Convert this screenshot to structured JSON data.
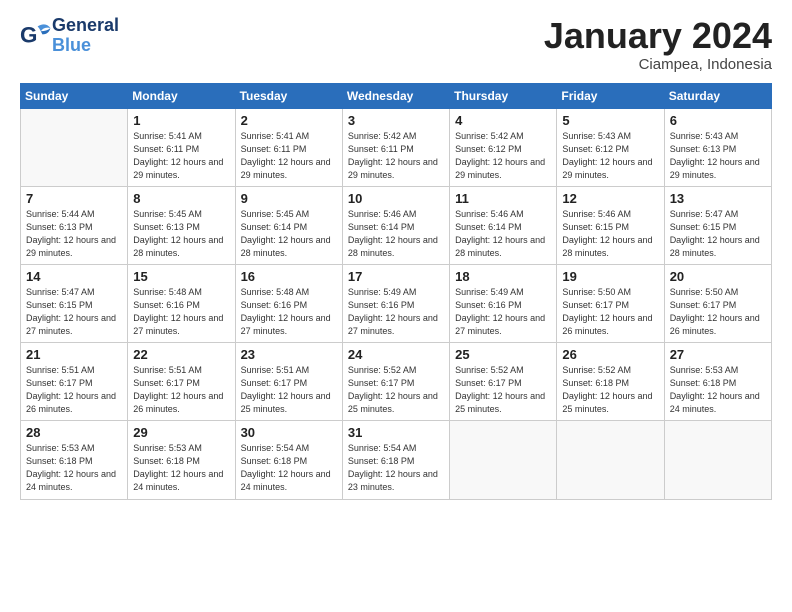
{
  "logo": {
    "line1": "General",
    "line2": "Blue"
  },
  "header": {
    "month": "January 2024",
    "location": "Ciampea, Indonesia"
  },
  "weekdays": [
    "Sunday",
    "Monday",
    "Tuesday",
    "Wednesday",
    "Thursday",
    "Friday",
    "Saturday"
  ],
  "weeks": [
    [
      {
        "day": "",
        "info": ""
      },
      {
        "day": "1",
        "info": "Sunrise: 5:41 AM\nSunset: 6:11 PM\nDaylight: 12 hours\nand 29 minutes."
      },
      {
        "day": "2",
        "info": "Sunrise: 5:41 AM\nSunset: 6:11 PM\nDaylight: 12 hours\nand 29 minutes."
      },
      {
        "day": "3",
        "info": "Sunrise: 5:42 AM\nSunset: 6:11 PM\nDaylight: 12 hours\nand 29 minutes."
      },
      {
        "day": "4",
        "info": "Sunrise: 5:42 AM\nSunset: 6:12 PM\nDaylight: 12 hours\nand 29 minutes."
      },
      {
        "day": "5",
        "info": "Sunrise: 5:43 AM\nSunset: 6:12 PM\nDaylight: 12 hours\nand 29 minutes."
      },
      {
        "day": "6",
        "info": "Sunrise: 5:43 AM\nSunset: 6:13 PM\nDaylight: 12 hours\nand 29 minutes."
      }
    ],
    [
      {
        "day": "7",
        "info": "Sunrise: 5:44 AM\nSunset: 6:13 PM\nDaylight: 12 hours\nand 29 minutes."
      },
      {
        "day": "8",
        "info": "Sunrise: 5:45 AM\nSunset: 6:13 PM\nDaylight: 12 hours\nand 28 minutes."
      },
      {
        "day": "9",
        "info": "Sunrise: 5:45 AM\nSunset: 6:14 PM\nDaylight: 12 hours\nand 28 minutes."
      },
      {
        "day": "10",
        "info": "Sunrise: 5:46 AM\nSunset: 6:14 PM\nDaylight: 12 hours\nand 28 minutes."
      },
      {
        "day": "11",
        "info": "Sunrise: 5:46 AM\nSunset: 6:14 PM\nDaylight: 12 hours\nand 28 minutes."
      },
      {
        "day": "12",
        "info": "Sunrise: 5:46 AM\nSunset: 6:15 PM\nDaylight: 12 hours\nand 28 minutes."
      },
      {
        "day": "13",
        "info": "Sunrise: 5:47 AM\nSunset: 6:15 PM\nDaylight: 12 hours\nand 28 minutes."
      }
    ],
    [
      {
        "day": "14",
        "info": "Sunrise: 5:47 AM\nSunset: 6:15 PM\nDaylight: 12 hours\nand 27 minutes."
      },
      {
        "day": "15",
        "info": "Sunrise: 5:48 AM\nSunset: 6:16 PM\nDaylight: 12 hours\nand 27 minutes."
      },
      {
        "day": "16",
        "info": "Sunrise: 5:48 AM\nSunset: 6:16 PM\nDaylight: 12 hours\nand 27 minutes."
      },
      {
        "day": "17",
        "info": "Sunrise: 5:49 AM\nSunset: 6:16 PM\nDaylight: 12 hours\nand 27 minutes."
      },
      {
        "day": "18",
        "info": "Sunrise: 5:49 AM\nSunset: 6:16 PM\nDaylight: 12 hours\nand 27 minutes."
      },
      {
        "day": "19",
        "info": "Sunrise: 5:50 AM\nSunset: 6:17 PM\nDaylight: 12 hours\nand 26 minutes."
      },
      {
        "day": "20",
        "info": "Sunrise: 5:50 AM\nSunset: 6:17 PM\nDaylight: 12 hours\nand 26 minutes."
      }
    ],
    [
      {
        "day": "21",
        "info": "Sunrise: 5:51 AM\nSunset: 6:17 PM\nDaylight: 12 hours\nand 26 minutes."
      },
      {
        "day": "22",
        "info": "Sunrise: 5:51 AM\nSunset: 6:17 PM\nDaylight: 12 hours\nand 26 minutes."
      },
      {
        "day": "23",
        "info": "Sunrise: 5:51 AM\nSunset: 6:17 PM\nDaylight: 12 hours\nand 25 minutes."
      },
      {
        "day": "24",
        "info": "Sunrise: 5:52 AM\nSunset: 6:17 PM\nDaylight: 12 hours\nand 25 minutes."
      },
      {
        "day": "25",
        "info": "Sunrise: 5:52 AM\nSunset: 6:17 PM\nDaylight: 12 hours\nand 25 minutes."
      },
      {
        "day": "26",
        "info": "Sunrise: 5:52 AM\nSunset: 6:18 PM\nDaylight: 12 hours\nand 25 minutes."
      },
      {
        "day": "27",
        "info": "Sunrise: 5:53 AM\nSunset: 6:18 PM\nDaylight: 12 hours\nand 24 minutes."
      }
    ],
    [
      {
        "day": "28",
        "info": "Sunrise: 5:53 AM\nSunset: 6:18 PM\nDaylight: 12 hours\nand 24 minutes."
      },
      {
        "day": "29",
        "info": "Sunrise: 5:53 AM\nSunset: 6:18 PM\nDaylight: 12 hours\nand 24 minutes."
      },
      {
        "day": "30",
        "info": "Sunrise: 5:54 AM\nSunset: 6:18 PM\nDaylight: 12 hours\nand 24 minutes."
      },
      {
        "day": "31",
        "info": "Sunrise: 5:54 AM\nSunset: 6:18 PM\nDaylight: 12 hours\nand 23 minutes."
      },
      {
        "day": "",
        "info": ""
      },
      {
        "day": "",
        "info": ""
      },
      {
        "day": "",
        "info": ""
      }
    ]
  ]
}
